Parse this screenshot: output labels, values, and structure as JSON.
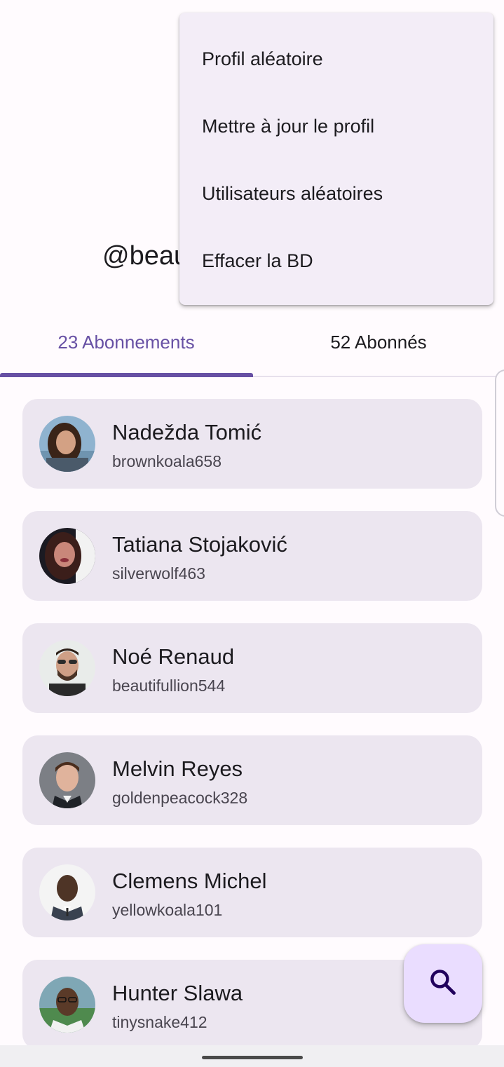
{
  "profile": {
    "handle": "@beau"
  },
  "tabs": [
    {
      "label": "23 Abonnements",
      "active": true
    },
    {
      "label": "52 Abonnés",
      "active": false
    }
  ],
  "menu": {
    "items": [
      {
        "label": "Profil aléatoire"
      },
      {
        "label": "Mettre à jour le profil"
      },
      {
        "label": "Utilisateurs aléatoires"
      },
      {
        "label": "Effacer la BD"
      }
    ]
  },
  "list": {
    "items": [
      {
        "name": "Nadežda Tomić",
        "username": "brownkoala658"
      },
      {
        "name": "Tatiana Stojaković",
        "username": "silverwolf463"
      },
      {
        "name": "Noé Renaud",
        "username": "beautifullion544"
      },
      {
        "name": "Melvin Reyes",
        "username": "goldenpeacock328"
      },
      {
        "name": "Clemens Michel",
        "username": "yellowkoala101"
      },
      {
        "name": "Hunter Slawa",
        "username": "tinysnake412"
      }
    ]
  },
  "fab": {
    "icon": "search-icon"
  },
  "colors": {
    "accent": "#6750a4",
    "card": "#ece6f0",
    "menu": "#f3edf7",
    "fab": "#eaddff"
  }
}
